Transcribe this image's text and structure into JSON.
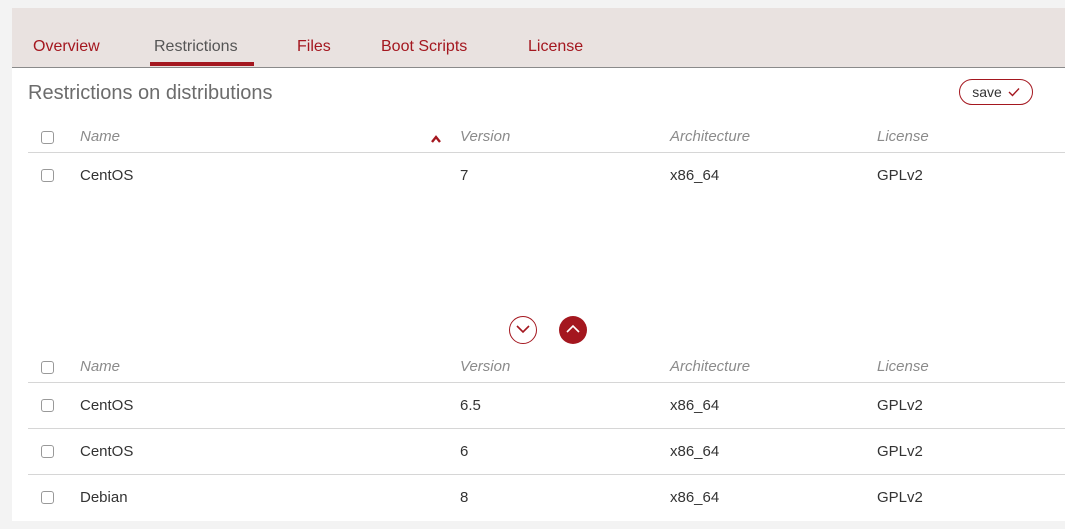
{
  "tabs": [
    {
      "label": "Overview"
    },
    {
      "label": "Restrictions"
    },
    {
      "label": "Files"
    },
    {
      "label": "Boot Scripts"
    },
    {
      "label": "License"
    }
  ],
  "active_tab": "Restrictions",
  "section": {
    "title": "Restrictions on distributions",
    "save_label": "save"
  },
  "columns": {
    "name": "Name",
    "version": "Version",
    "architecture": "Architecture",
    "license": "License"
  },
  "restricted_table": {
    "sorted_column": "Version",
    "sort_direction": "ascending",
    "rows": [
      {
        "name": "CentOS",
        "version": "7",
        "architecture": "x86_64",
        "license": "GPLv2"
      }
    ]
  },
  "available_table": {
    "rows": [
      {
        "name": "CentOS",
        "version": "6.5",
        "architecture": "x86_64",
        "license": "GPLv2"
      },
      {
        "name": "CentOS",
        "version": "6",
        "architecture": "x86_64",
        "license": "GPLv2"
      },
      {
        "name": "Debian",
        "version": "8",
        "architecture": "x86_64",
        "license": "GPLv2"
      }
    ]
  },
  "icons": {
    "save": "checkmark-icon",
    "sort": "caret-up-icon",
    "move_down": "chevron-down-circle-icon",
    "move_up": "chevron-up-circle-icon"
  },
  "colors": {
    "accent": "#a4171f",
    "tabbar_bg": "#e9e2e0",
    "divider": "#d6d6d6"
  }
}
